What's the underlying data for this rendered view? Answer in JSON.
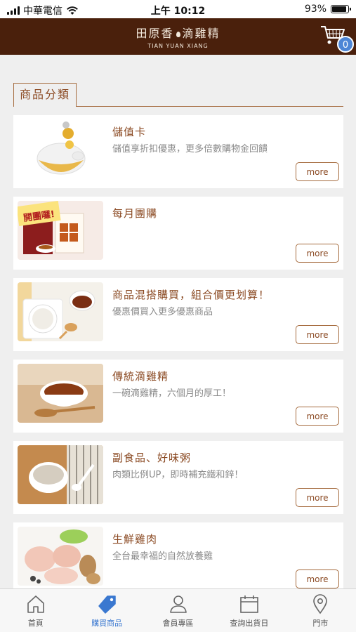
{
  "status": {
    "carrier": "中華電信",
    "time": "上午 10:12",
    "battery": "93%"
  },
  "header": {
    "logo_cn_left": "田原香",
    "logo_cn_right": "滴雞精",
    "logo_en": "TIAN YUAN XIANG",
    "cart_count": "0"
  },
  "section": {
    "title": "商品分類"
  },
  "categories": [
    {
      "title": "儲值卡",
      "desc": "儲值享折扣優惠，更多倍數購物金回饋",
      "more": "more"
    },
    {
      "title": "每月團購",
      "desc": "",
      "more": "more",
      "thumb_text": "開團囉!"
    },
    {
      "title": "商品混搭購買，組合價更划算！",
      "desc": "優惠價買入更多優惠商品",
      "more": "more"
    },
    {
      "title": "傳統滴雞精",
      "desc": "一碗滴雞精，六個月的厚工！",
      "more": "more"
    },
    {
      "title": "副食品、好味粥",
      "desc": "肉類比例UP，即時補充鐵和鋅！",
      "more": "more"
    },
    {
      "title": "生鮮雞肉",
      "desc": "全台最幸福的自然放養雞",
      "more": "more"
    }
  ],
  "tabs": [
    {
      "label": "首頁",
      "icon": "home-icon"
    },
    {
      "label": "購買商品",
      "icon": "tag-icon",
      "active": true
    },
    {
      "label": "會員專區",
      "icon": "user-icon"
    },
    {
      "label": "查詢出貨日",
      "icon": "calendar-icon"
    },
    {
      "label": "門市",
      "icon": "location-icon"
    }
  ],
  "colors": {
    "header_bg": "#4a200c",
    "accent_brown": "#8b4a23",
    "active_tab": "#3a78d0"
  }
}
